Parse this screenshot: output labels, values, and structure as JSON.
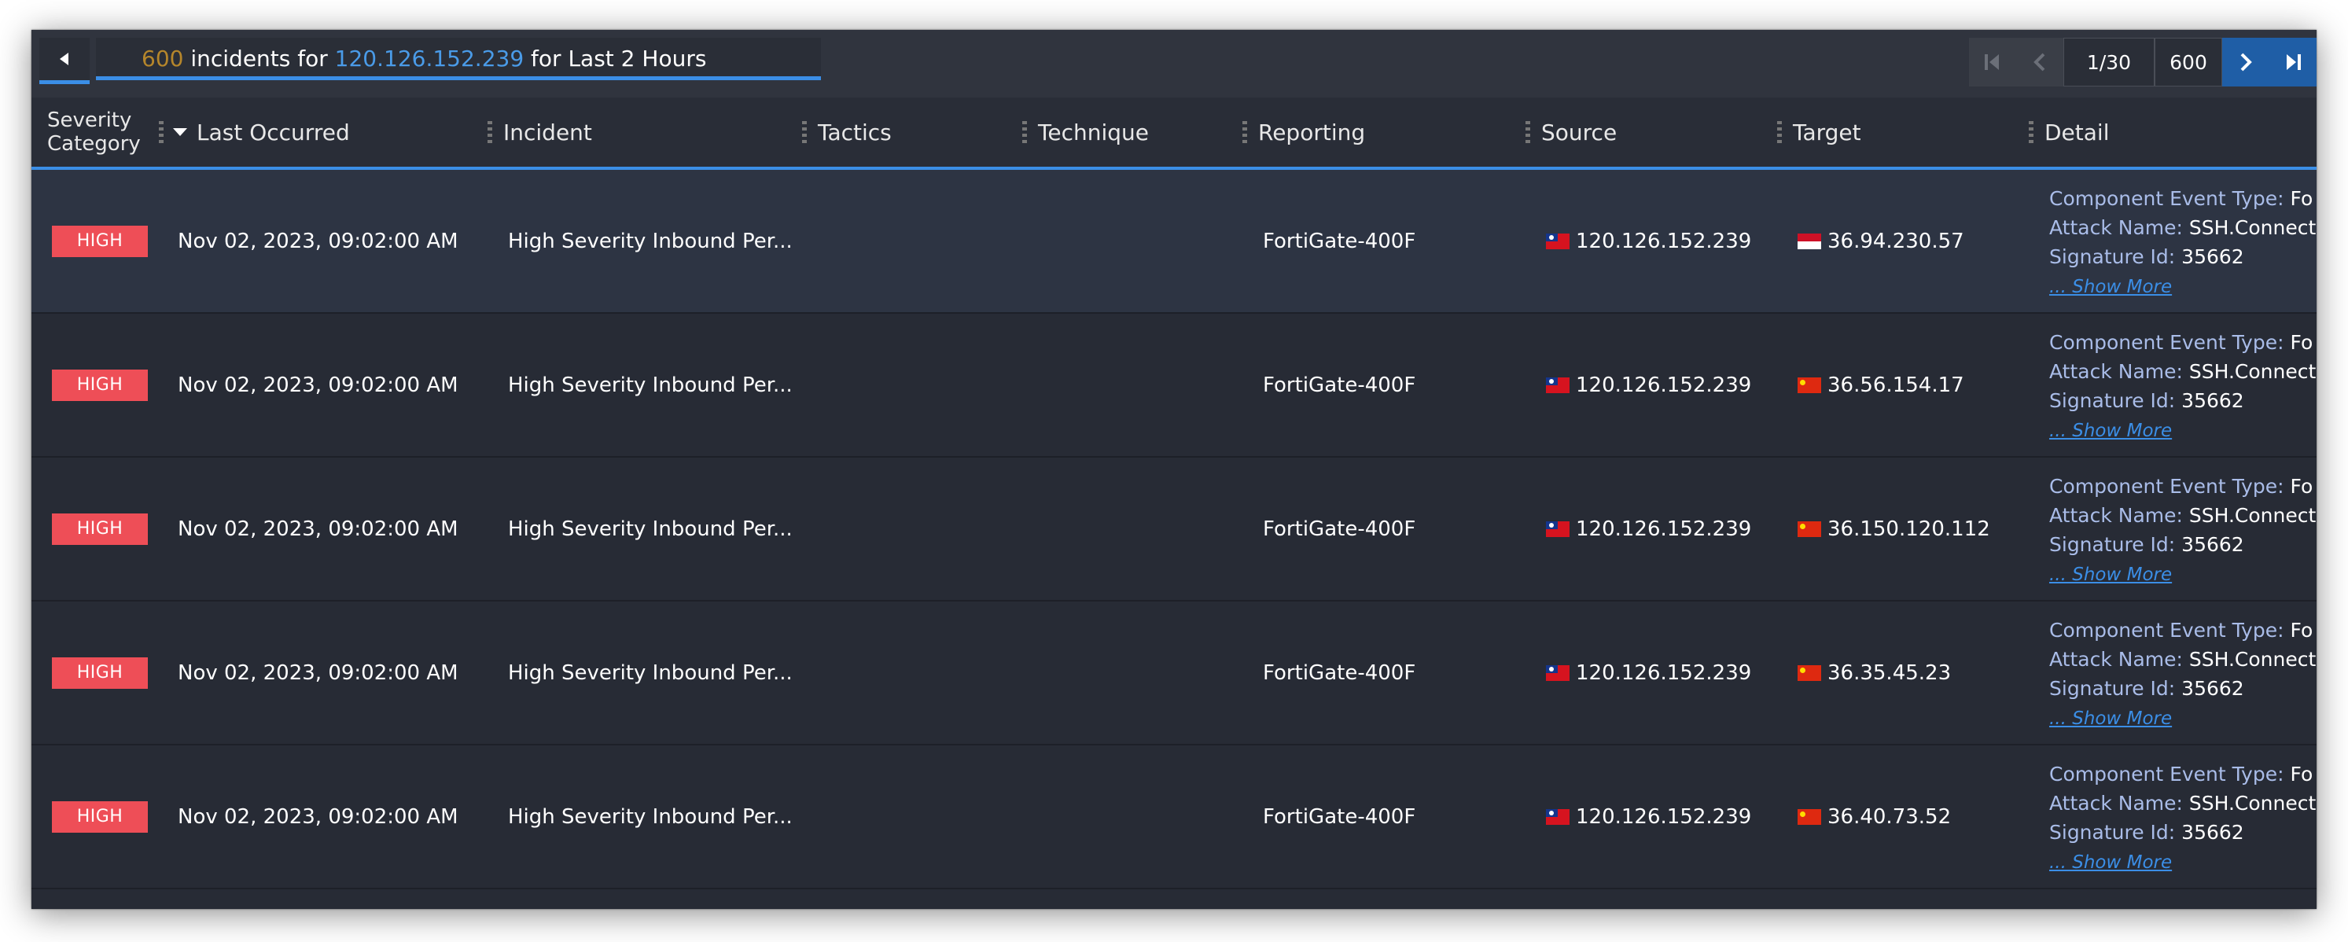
{
  "header_bar": {
    "count": "600",
    "text_1": " incidents for ",
    "ip": "120.126.152.239",
    "text_2": " for Last 2 Hours"
  },
  "pager": {
    "page": "1/30",
    "total": "600"
  },
  "columns": {
    "severity": "Severity Category",
    "last_occurred": "Last Occurred",
    "incident": "Incident",
    "tactics": "Tactics",
    "technique": "Technique",
    "reporting": "Reporting",
    "source": "Source",
    "target": "Target",
    "detail": "Detail"
  },
  "detail_labels": {
    "component_event_type": "Component Event Type:",
    "attack_name": "Attack Name:",
    "signature_id": "Signature Id:",
    "show_more": "... Show More"
  },
  "rows": [
    {
      "severity": "HIGH",
      "last_occurred": "Nov 02, 2023, 09:02:00 AM",
      "incident": "High Severity Inbound Per...",
      "reporting": "FortiGate-400F",
      "source": "120.126.152.239",
      "target": "36.94.230.57",
      "component_event_type": "Fo",
      "attack_name": "SSH.Connect",
      "signature_id": "35662"
    },
    {
      "severity": "HIGH",
      "last_occurred": "Nov 02, 2023, 09:02:00 AM",
      "incident": "High Severity Inbound Per...",
      "reporting": "FortiGate-400F",
      "source": "120.126.152.239",
      "target": "36.56.154.17",
      "component_event_type": "Fo",
      "attack_name": "SSH.Connect",
      "signature_id": "35662"
    },
    {
      "severity": "HIGH",
      "last_occurred": "Nov 02, 2023, 09:02:00 AM",
      "incident": "High Severity Inbound Per...",
      "reporting": "FortiGate-400F",
      "source": "120.126.152.239",
      "target": "36.150.120.112",
      "component_event_type": "Fo",
      "attack_name": "SSH.Connect",
      "signature_id": "35662"
    },
    {
      "severity": "HIGH",
      "last_occurred": "Nov 02, 2023, 09:02:00 AM",
      "incident": "High Severity Inbound Per...",
      "reporting": "FortiGate-400F",
      "source": "120.126.152.239",
      "target": "36.35.45.23",
      "component_event_type": "Fo",
      "attack_name": "SSH.Connect",
      "signature_id": "35662"
    },
    {
      "severity": "HIGH",
      "last_occurred": "Nov 02, 2023, 09:02:00 AM",
      "incident": "High Severity Inbound Per...",
      "reporting": "FortiGate-400F",
      "source": "120.126.152.239",
      "target": "36.40.73.52",
      "component_event_type": "Fo",
      "attack_name": "SSH.Connect",
      "signature_id": "35662"
    }
  ]
}
